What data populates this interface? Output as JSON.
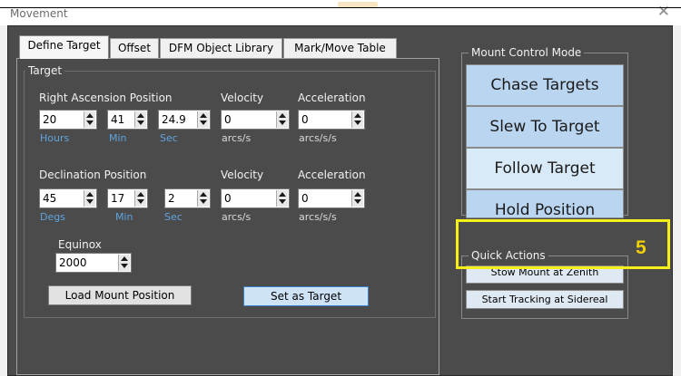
{
  "window": {
    "title": "Movement",
    "close_icon": "close-icon"
  },
  "tabs": [
    {
      "label": "Define Target",
      "active": true
    },
    {
      "label": "Offset",
      "active": false
    },
    {
      "label": "DFM Object Library",
      "active": false
    },
    {
      "label": "Mark/Move Table",
      "active": false
    }
  ],
  "target": {
    "group_label": "Target",
    "ra": {
      "position_label": "Right Ascension Position",
      "velocity_label": "Velocity",
      "acceleration_label": "Acceleration",
      "hours": "20",
      "min": "41",
      "sec": "24.9",
      "velocity": "0",
      "acceleration": "0",
      "hours_unit": "Hours",
      "min_unit": "Min",
      "sec_unit": "Sec",
      "velocity_unit": "arcs/s",
      "acceleration_unit": "arcs/s/s"
    },
    "dec": {
      "position_label": "Declination Position",
      "velocity_label": "Velocity",
      "acceleration_label": "Acceleration",
      "degs": "45",
      "min": "17",
      "sec": "2",
      "velocity": "0",
      "acceleration": "0",
      "degs_unit": "Degs",
      "min_unit": "Min",
      "sec_unit": "Sec",
      "velocity_unit": "arcs/s",
      "acceleration_unit": "arcs/s/s"
    },
    "equinox_label": "Equinox",
    "equinox_value": "2000",
    "load_button": "Load Mount Position",
    "set_button": "Set as Target"
  },
  "mount_control": {
    "group_label": "Mount Control Mode",
    "buttons": [
      "Chase Targets",
      "Slew To Target",
      "Follow Target",
      "Hold Position"
    ]
  },
  "quick_actions": {
    "group_label": "Quick Actions",
    "buttons": [
      "Stow Mount at Zenith",
      "Start Tracking at Sidereal"
    ]
  },
  "annotation": {
    "step_number": "5",
    "highlight_color": "#f5ef1a"
  },
  "colors": {
    "panel_bg": "#4b4b4b",
    "unit_blue": "#5fa3e0",
    "button_blue": "#b9d5f0"
  }
}
